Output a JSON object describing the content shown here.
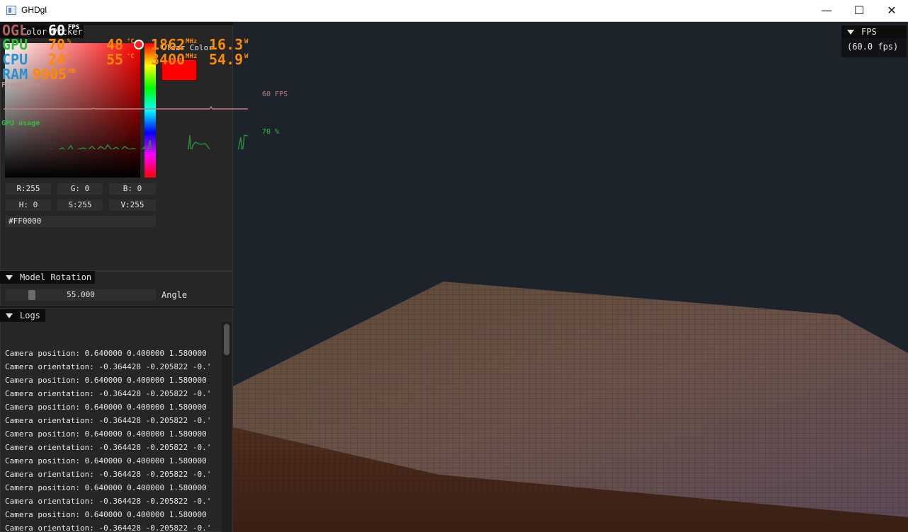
{
  "window": {
    "title": "GHDgl",
    "minimize": "—",
    "maximize": "☐",
    "close": "✕"
  },
  "osd": {
    "api": "OGL",
    "fps_value": "60",
    "fps_unit": "FPS",
    "gpu_label": "GPU",
    "gpu_load": "70",
    "gpu_load_unit": "%",
    "gpu_temp": "48",
    "gpu_temp_unit": "°C",
    "gpu_clock": "1862",
    "gpu_clock_unit": "MHz",
    "gpu_power": "16.3",
    "gpu_power_unit": "W",
    "cpu_label": "CPU",
    "cpu_load": "24",
    "cpu_load_unit": "%",
    "cpu_temp": "55",
    "cpu_temp_unit": "°C",
    "cpu_clock": "3400",
    "cpu_clock_unit": "MHz",
    "cpu_power": "54.9",
    "cpu_power_unit": "W",
    "ram_label": "RAM",
    "ram_value": "9905",
    "ram_unit": "MB",
    "framerate_label": "Framerate",
    "framerate_graph_value": "60 FPS",
    "gpu_usage_label": "GPU usage",
    "gpu_usage_graph_value": "70 %"
  },
  "color_picker": {
    "title": "Color Picker",
    "clear_color_label": "Clear Color",
    "swatch_color": "#ff0000",
    "r": "R:255",
    "g": "G:  0",
    "b": "B:  0",
    "h": "H:  0",
    "s": "S:255",
    "v": "V:255",
    "hex": "#FF0000"
  },
  "model_rotation": {
    "title": "Model Rotation",
    "slider_value": "55.000",
    "slider_label": "Angle",
    "slider_fraction": 0.153
  },
  "logs": {
    "title": "Logs",
    "lines": [
      "Camera position: 0.640000 0.400000 1.580000",
      "Camera orientation: -0.364428 -0.205822 -0.'",
      "Camera position: 0.640000 0.400000 1.580000",
      "Camera orientation: -0.364428 -0.205822 -0.'",
      "Camera position: 0.640000 0.400000 1.580000",
      "Camera orientation: -0.364428 -0.205822 -0.'",
      "Camera position: 0.640000 0.400000 1.580000",
      "Camera orientation: -0.364428 -0.205822 -0.'",
      "Camera position: 0.640000 0.400000 1.580000",
      "Camera orientation: -0.364428 -0.205822 -0.'",
      "Camera position: 0.640000 0.400000 1.580000",
      "Camera orientation: -0.364428 -0.205822 -0.'",
      "Camera position: 0.640000 0.400000 1.580000",
      "Camera orientation: -0.364428 -0.205822 -0.'",
      "Camera position: 0.640000 0.400000 1.580000"
    ]
  },
  "fps_window": {
    "title": "FPS",
    "value": "(60.0 fps)"
  },
  "colors": {
    "osd_orange": "#ff8a00",
    "osd_green": "#2fbf3c",
    "osd_blue": "#2a8fd0",
    "osd_red": "#d05050",
    "graph_framerate": "#c08080",
    "graph_gpu": "#2d8a3a"
  }
}
